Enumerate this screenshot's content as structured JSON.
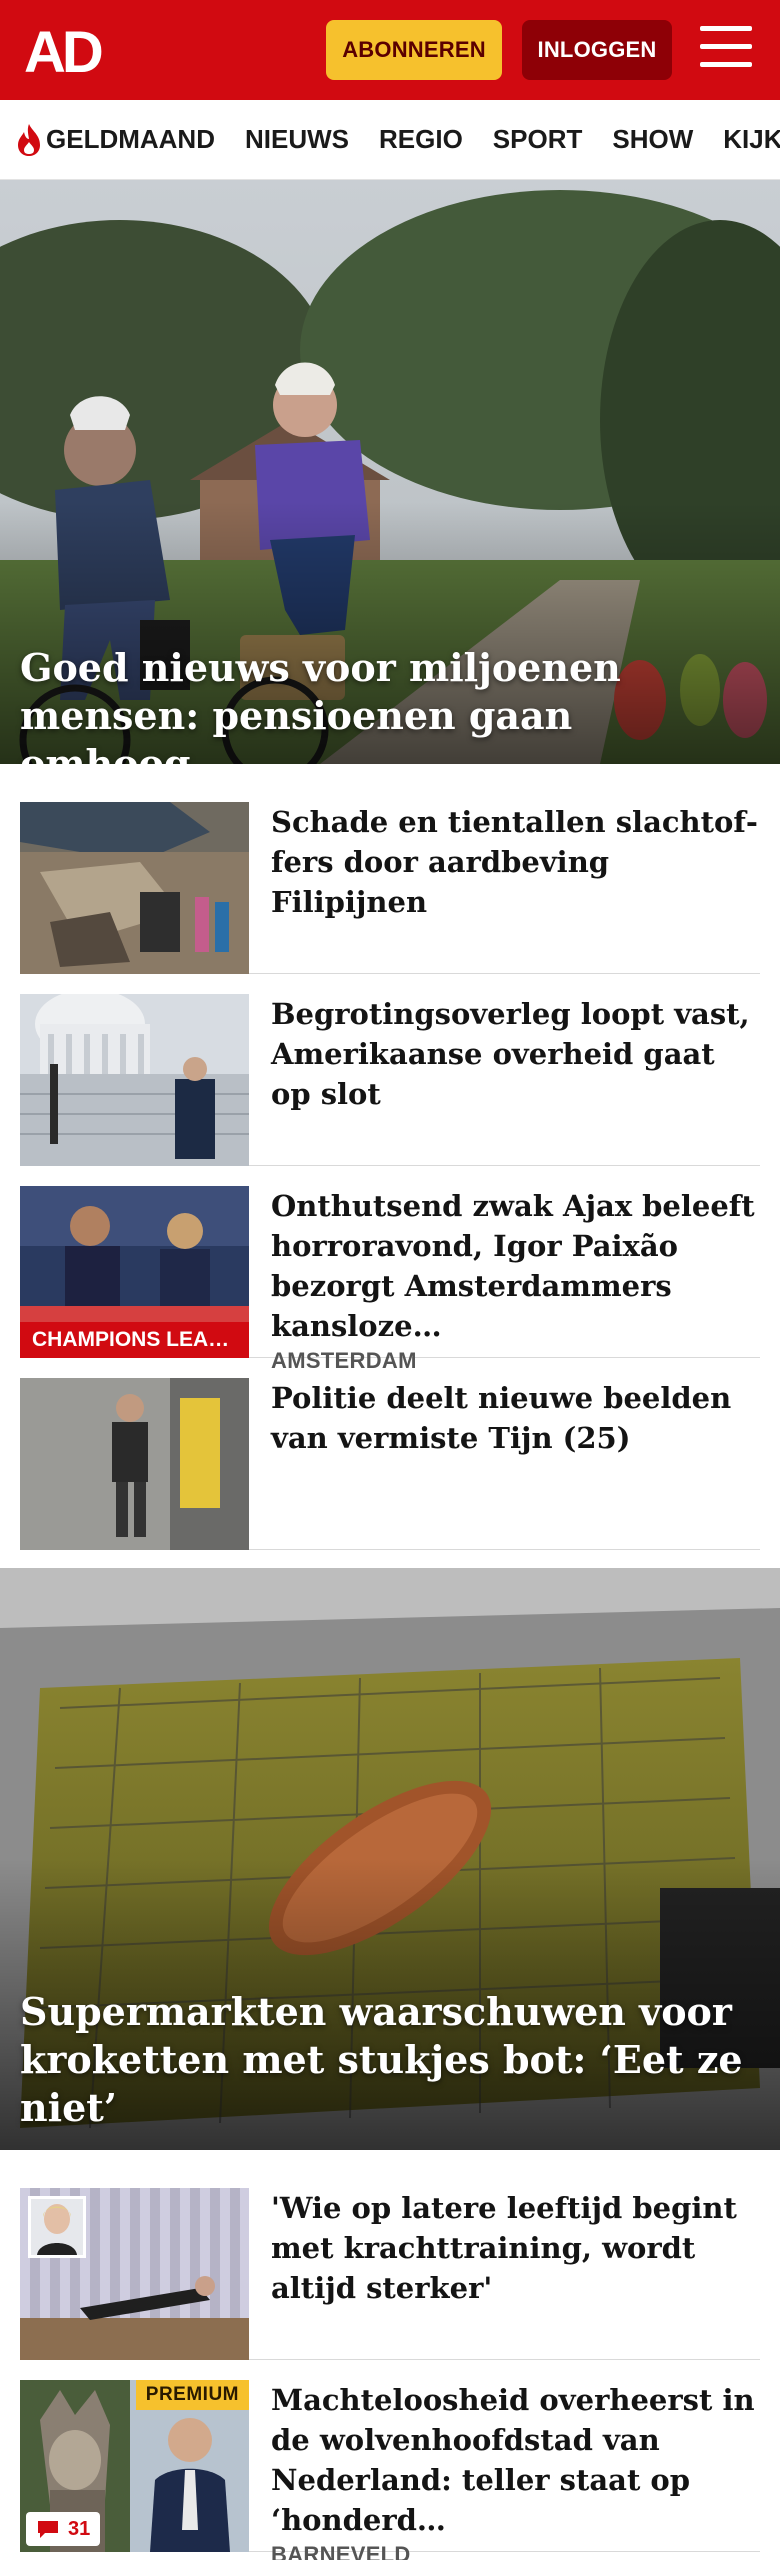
{
  "header": {
    "logo": "AD",
    "subscribe_label": "ABONNEREN",
    "login_label": "INLOGGEN",
    "menu_icon": "hamburger-menu-icon",
    "brand_color": "#d10a11",
    "accent_color": "#f6c12d"
  },
  "nav": {
    "items": [
      {
        "label": "GELDMAAND",
        "icon": "flame-icon"
      },
      {
        "label": "NIEUWS"
      },
      {
        "label": "REGIO"
      },
      {
        "label": "SPORT"
      },
      {
        "label": "SHOW"
      },
      {
        "label": "KIJK"
      }
    ]
  },
  "hero1": {
    "title": "Goed nieuws voor miljoenen mensen: pensioenen gaan omhoog"
  },
  "articles1": [
    {
      "title": "Schade en tientallen slachtof­fers door aardbeving Filipijnen",
      "meta": "",
      "tag": ""
    },
    {
      "title": "Begrotingsoverleg loopt vast, Amerikaanse overheid gaat op slot",
      "meta": "",
      "tag": ""
    },
    {
      "title": "Onthutsend zwak Ajax beleeft horroravond, Igor Paixão bezorgt Amsterdammers kansloze…",
      "meta": "AMSTERDAM",
      "tag": "CHAMPIONS LEA…"
    },
    {
      "title": "Politie deelt nieuwe beelden van vermiste Tijn (25)",
      "meta": "",
      "tag": ""
    }
  ],
  "hero2": {
    "title": "Supermarkten waarschuwen voor kroketten met stukjes bot: ‘Eet ze niet’"
  },
  "articles2": [
    {
      "title": "'Wie op latere leeftijd begint met krachttraining, wordt altijd sterker'",
      "meta": ""
    },
    {
      "title": "Machteloosheid overheerst in de wolvenhoofdstad van Nederland: teller staat op ‘honderd…",
      "meta": "BARNEVELD",
      "badge": "PREMIUM",
      "comments": "31"
    }
  ]
}
